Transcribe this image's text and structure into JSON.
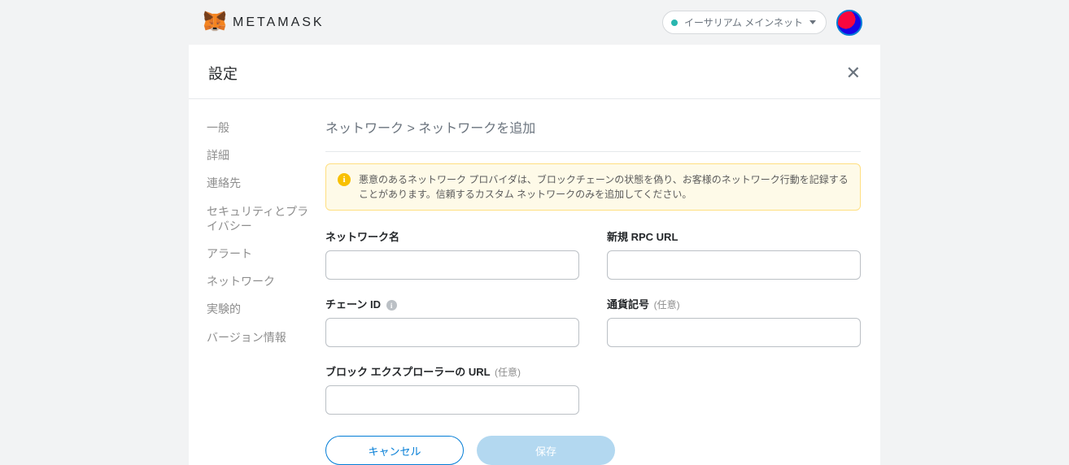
{
  "header": {
    "brand": "METAMASK",
    "network_label": "イーサリアム メインネット"
  },
  "panel": {
    "title": "設定"
  },
  "sidebar": {
    "items": [
      {
        "label": "一般"
      },
      {
        "label": "詳細"
      },
      {
        "label": "連絡先"
      },
      {
        "label": "セキュリティとプライバシー"
      },
      {
        "label": "アラート"
      },
      {
        "label": "ネットワーク"
      },
      {
        "label": "実験的"
      },
      {
        "label": "バージョン情報"
      }
    ]
  },
  "content": {
    "breadcrumb_root": "ネットワーク",
    "breadcrumb_sep": " > ",
    "breadcrumb_leaf": "ネットワークを追加",
    "warning_text": "悪意のあるネットワーク プロバイダは、ブロックチェーンの状態を偽り、お客様のネットワーク行動を記録することがあります。信頼するカスタム ネットワークのみを追加してください。",
    "fields": {
      "network_name": {
        "label": "ネットワーク名",
        "value": ""
      },
      "rpc_url": {
        "label": "新規 RPC URL",
        "value": ""
      },
      "chain_id": {
        "label": "チェーン ID",
        "value": ""
      },
      "currency_symbol": {
        "label": "通貨記号",
        "optional": "(任意)",
        "value": ""
      },
      "block_explorer": {
        "label": "ブロック エクスプローラーの URL",
        "optional": "(任意)",
        "value": ""
      }
    },
    "buttons": {
      "cancel": "キャンセル",
      "save": "保存"
    }
  }
}
